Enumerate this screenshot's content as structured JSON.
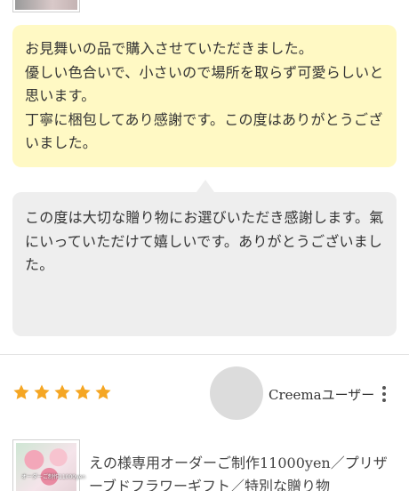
{
  "review": {
    "text": "お見舞いの品で購入させていただきました。\n優しい色合いで、小さいので場所を取らず可愛らしいと思います。\n丁寧に梱包してあり感謝です。この度はありがとうございました。"
  },
  "reply": {
    "text": "この度は大切な贈り物にお選びいただき感謝します。氣にいっていただけて嬉しいです。ありがとうございました。"
  },
  "next_review": {
    "rating": 5,
    "star_color": "#f5a623",
    "user_name": "Creemaユーザー",
    "product_thumb_caption": "オーダーご制作11000yen",
    "product_title": "えの様専用オーダーご制作11000yen／プリザーブドフラワーギフト／特別な贈り物"
  }
}
